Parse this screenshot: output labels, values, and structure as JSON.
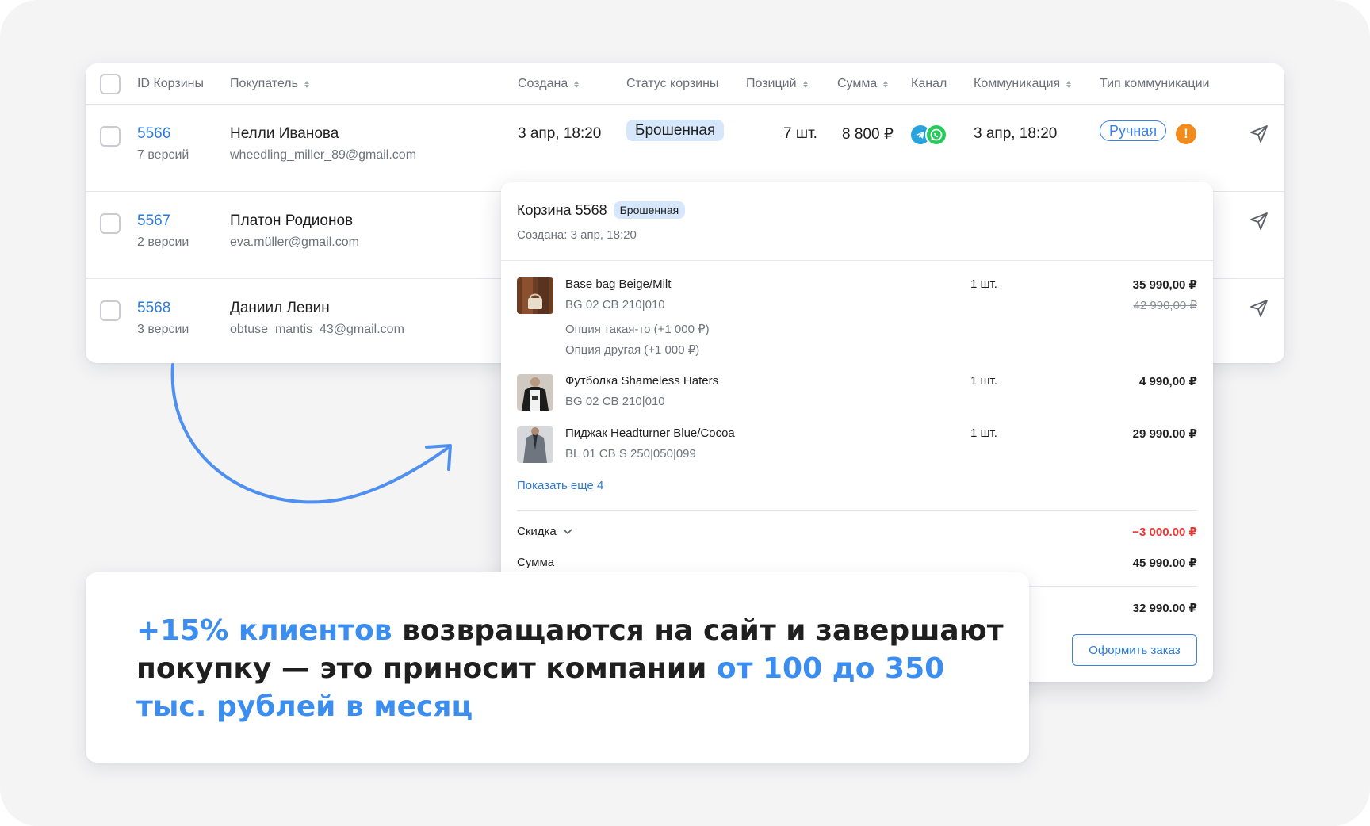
{
  "table": {
    "headers": {
      "id": "ID Корзины",
      "buyer": "Покупатель",
      "created": "Создана",
      "status": "Статус корзины",
      "positions": "Позиций",
      "sum": "Сумма",
      "channel": "Канал",
      "communication": "Коммуникация",
      "comm_type": "Тип коммуникации"
    },
    "rows": [
      {
        "id": "5566",
        "versions": "7 версий",
        "name": "Нелли Иванова",
        "email": "wheedling_miller_89@gmail.com",
        "created": "3 апр, 18:20",
        "status": "Брошенная",
        "positions": "7 шт.",
        "sum": "8 800 ₽",
        "communication": "3 апр, 18:20",
        "comm_type": "Ручная",
        "warning": "!"
      },
      {
        "id": "5567",
        "versions": "2 версии",
        "name": "Платон Родионов",
        "email": "eva.müller@gmail.com"
      },
      {
        "id": "5568",
        "versions": "3 версии",
        "name": "Даниил Левин",
        "email": "obtuse_mantis_43@gmail.com"
      }
    ]
  },
  "popup": {
    "title": "Корзина 5568",
    "status": "Брошенная",
    "created": "Создана: 3 апр, 18:20",
    "items": [
      {
        "name": "Base bag Beige/Milt",
        "sku": "BG 02 CB 210|010",
        "options": [
          "Опция такая-то (+1 000 ₽)",
          "Опция другая (+1 000 ₽)"
        ],
        "qty": "1 шт.",
        "price": "35 990,00 ₽",
        "old_price": "42 990,00 ₽"
      },
      {
        "name": "Футболка Shameless Haters",
        "sku": "BG 02 CB 210|010",
        "qty": "1 шт.",
        "price": "4 990,00 ₽"
      },
      {
        "name": "Пиджак Headturner Blue/Cocoa",
        "sku": "BL 01 CB S 250|050|099",
        "qty": "1 шт.",
        "price": "29 990.00 ₽"
      }
    ],
    "show_more": "Показать еще 4",
    "discount_label": "Скидка",
    "discount_value": "−3 000.00 ₽",
    "sum_label": "Сумма",
    "sum_value": "45 990.00 ₽",
    "total_value": "32 990.00 ₽",
    "order_button": "Оформить заказ"
  },
  "promo": {
    "hl1": "+15% клиентов",
    "text1": " возвращаются на сайт и завершают покупку — это приносит компании ",
    "hl2": "от 100 до 350 тыс. рублей в месяц"
  },
  "colors": {
    "accent": "#3b8ef0",
    "link": "#2e7ad6",
    "status_bg": "#d7e7fb",
    "warning": "#f28b1e",
    "discount": "#e53935",
    "background": "#f4f4f5"
  },
  "icons": {
    "checkbox": "checkbox-icon",
    "sort": "sort-icon",
    "telegram": "telegram-icon",
    "whatsapp": "whatsapp-icon",
    "send": "send-icon",
    "warning": "warning-icon",
    "chevron": "chevron-down-icon"
  }
}
